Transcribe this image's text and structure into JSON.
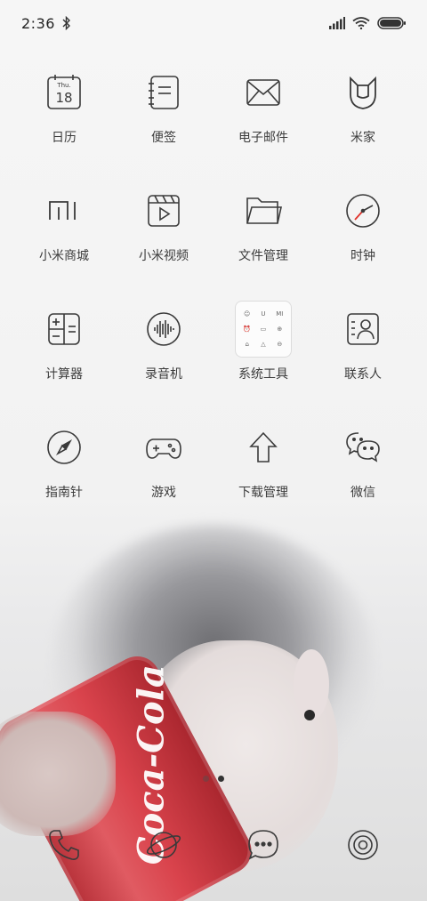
{
  "status_bar": {
    "time": "2:36",
    "icons": [
      "bluetooth-icon",
      "signal-icon",
      "wifi-icon",
      "battery-icon"
    ]
  },
  "apps": [
    {
      "label": "日历",
      "icon": "calendar-icon",
      "calendar_day": "Thu.",
      "calendar_date": "18"
    },
    {
      "label": "便签",
      "icon": "notes-icon"
    },
    {
      "label": "电子邮件",
      "icon": "mail-icon"
    },
    {
      "label": "米家",
      "icon": "mijia-icon"
    },
    {
      "label": "小米商城",
      "icon": "mi-store-icon",
      "icon_text": "mi"
    },
    {
      "label": "小米视频",
      "icon": "video-icon"
    },
    {
      "label": "文件管理",
      "icon": "folder-icon"
    },
    {
      "label": "时钟",
      "icon": "clock-icon"
    },
    {
      "label": "计算器",
      "icon": "calculator-icon"
    },
    {
      "label": "录音机",
      "icon": "recorder-icon"
    },
    {
      "label": "系统工具",
      "icon": "system-tools-folder",
      "folder_items": [
        "☺",
        "U",
        "MI",
        "⏰",
        "▭",
        "⊕",
        "⌂",
        "△",
        "⊖"
      ]
    },
    {
      "label": "联系人",
      "icon": "contacts-icon"
    },
    {
      "label": "指南针",
      "icon": "compass-icon"
    },
    {
      "label": "游戏",
      "icon": "gamepad-icon"
    },
    {
      "label": "下载管理",
      "icon": "download-icon"
    },
    {
      "label": "微信",
      "icon": "wechat-icon"
    }
  ],
  "pager": {
    "pages": 2,
    "active": 2
  },
  "dock": [
    {
      "icon": "phone-icon"
    },
    {
      "icon": "browser-icon"
    },
    {
      "icon": "messages-icon"
    },
    {
      "icon": "camera-icon"
    }
  ],
  "wallpaper": {
    "can_text": "Coca-Cola"
  },
  "colors": {
    "icon_stroke": "#3a3a3a",
    "label": "#3c3c3c",
    "clock_hand": "#e0322b"
  }
}
